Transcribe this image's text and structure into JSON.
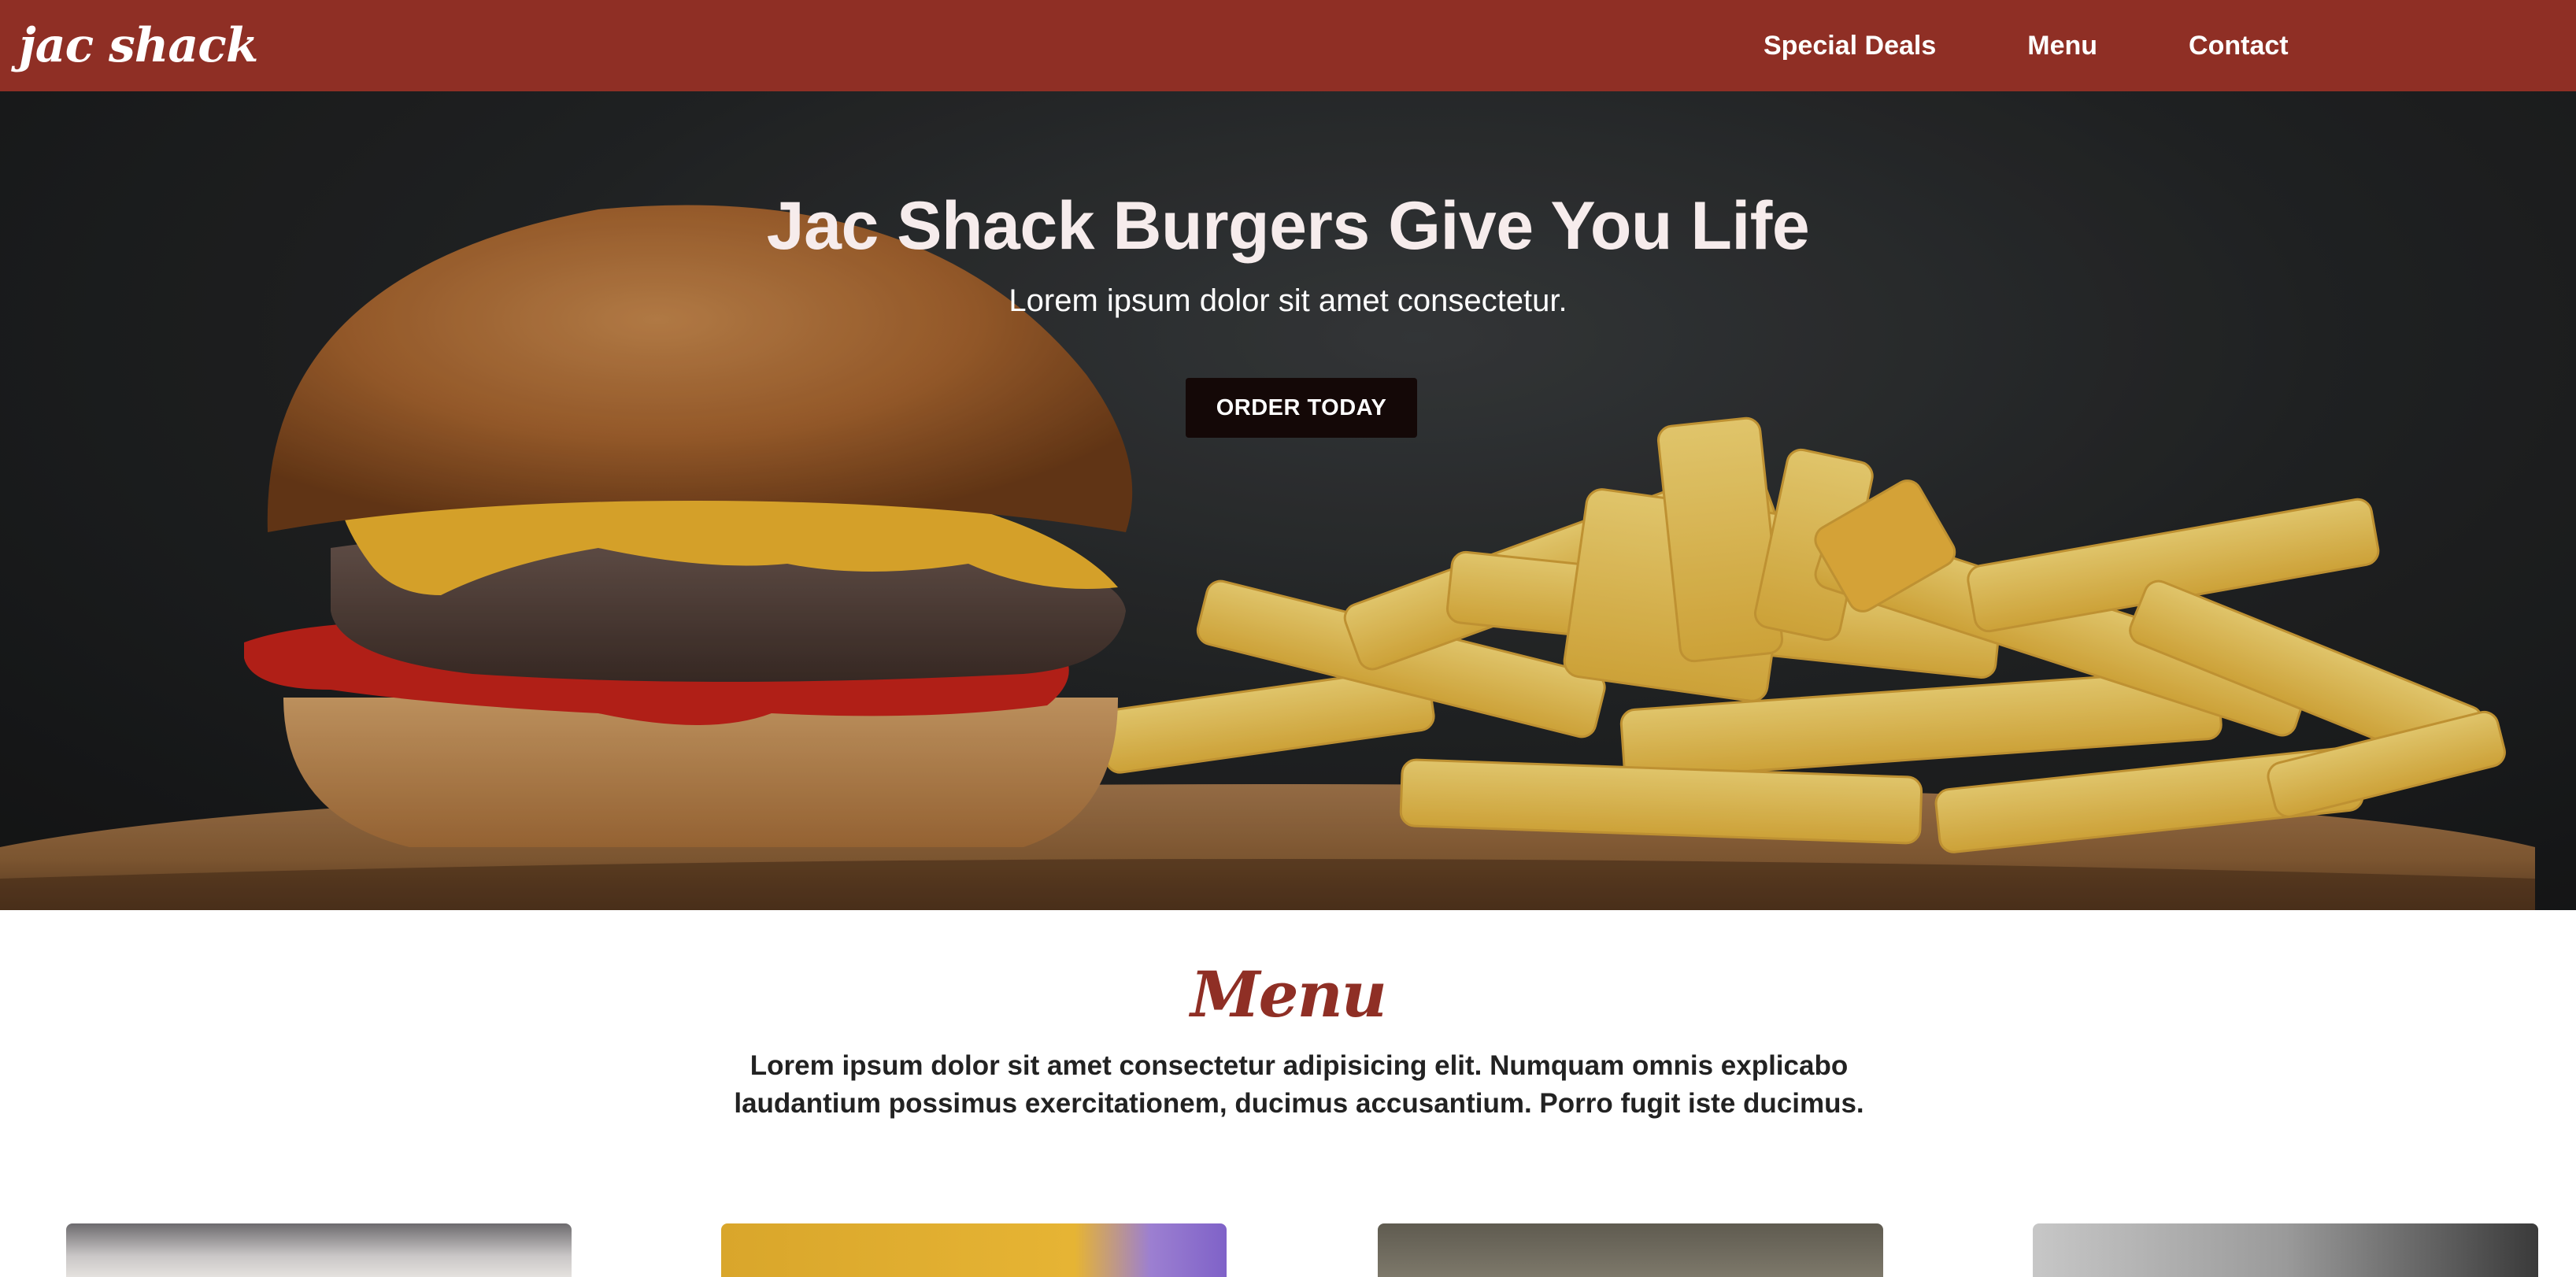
{
  "navbar": {
    "logo_text": "jac shack",
    "links": [
      {
        "label": "Special Deals"
      },
      {
        "label": "Menu"
      },
      {
        "label": "Contact"
      }
    ],
    "background_color": "#8f2f25"
  },
  "hero": {
    "title": "Jac Shack Burgers Give You Life",
    "subtitle": "Lorem ipsum dolor sit amet consectetur.",
    "cta_label": "ORDER TODAY",
    "image_icon": "burger-and-fries-image"
  },
  "menu_section": {
    "title": "Menu",
    "description": "Lorem ipsum dolor sit amet consectetur adipisicing elit. Numquam omnis explicabo laudantium possimus exercitationem, ducimus accusantium. Porro fugit iste ducimus.",
    "title_color": "#8f2f25"
  }
}
